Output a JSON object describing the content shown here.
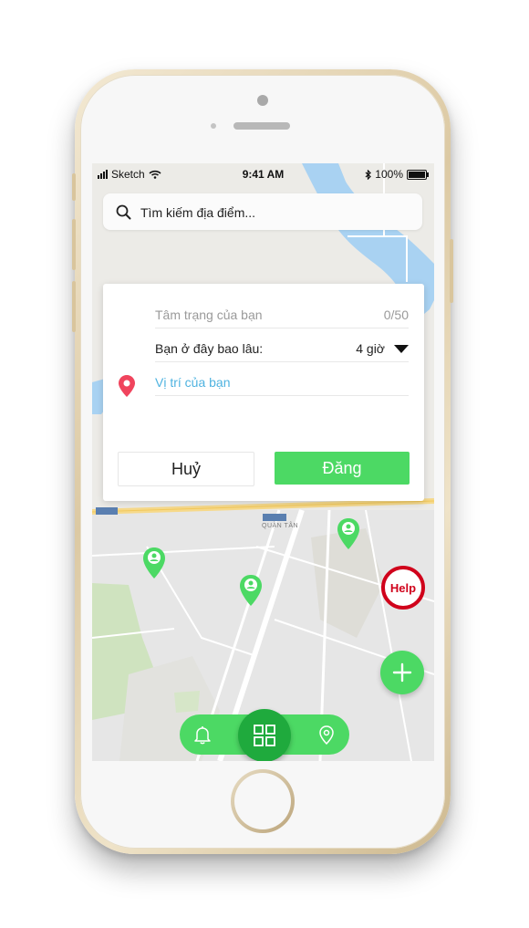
{
  "status_bar": {
    "carrier": "Sketch",
    "time": "9:41 AM",
    "battery": "100%"
  },
  "search": {
    "placeholder": "Tìm kiếm địa điểm..."
  },
  "dialog": {
    "mood_label": "Tâm trạng của bạn",
    "mood_count": "0/50",
    "stay_label": "Bạn ở đây bao lâu:",
    "stay_value": "4 giờ",
    "location_label": "Vị trí của bạn",
    "cancel_label": "Huỷ",
    "post_label": "Đăng"
  },
  "map": {
    "district_label": "QUẬN TÂN"
  },
  "help_label": "Help",
  "colors": {
    "accent": "#4cd964",
    "accent_dark": "#1faa3d",
    "help": "#d0021b",
    "location_text": "#4fb3e0",
    "pin": "#f0445d"
  },
  "icons": [
    "search-icon",
    "location-pin-icon",
    "user-marker-icon",
    "plus-icon",
    "bell-icon",
    "grid-icon",
    "map-pin-icon",
    "wifi-icon",
    "bluetooth-icon",
    "battery-icon"
  ]
}
